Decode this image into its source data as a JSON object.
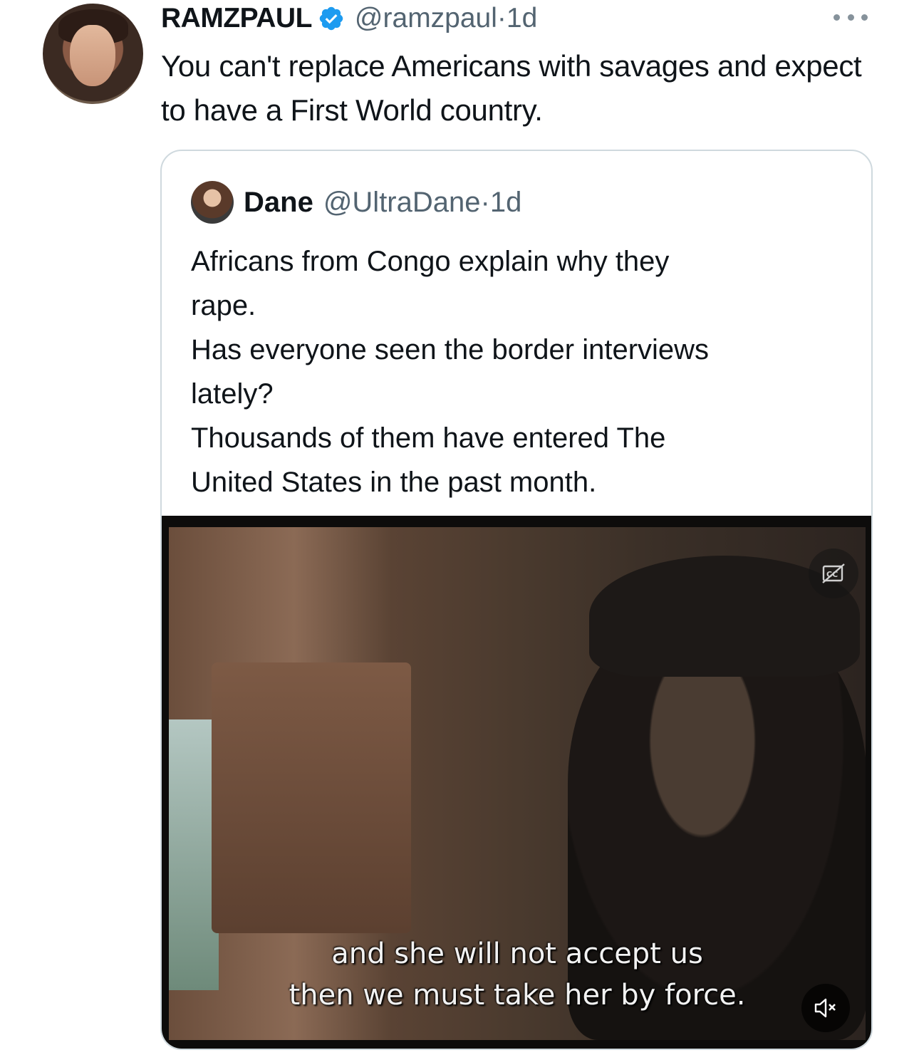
{
  "tweet": {
    "author_name": "RAMZPAUL",
    "handle": "@ramzpaul",
    "separator": "·",
    "time": "1d",
    "text": "You can't replace Americans with savages and expect to have a First World country.",
    "verified": true,
    "icons": {
      "verified": "verified-badge-icon",
      "more": "more-options-icon"
    },
    "accent_color": "#1d9bf0"
  },
  "quote": {
    "author_name": "Dane",
    "handle": "@UltraDane",
    "separator": "·",
    "time": "1d",
    "text_lines": [
      "Africans from Congo explain why they",
      "rape.",
      "Has everyone seen the border interviews",
      "lately?",
      "Thousands of them have entered The",
      "United States in the past month."
    ],
    "video": {
      "subtitle_lines": [
        "and she will not accept us",
        "then we must take her by force."
      ],
      "icons": {
        "captions": "captions-off-icon",
        "mute": "muted-speaker-icon"
      }
    }
  }
}
